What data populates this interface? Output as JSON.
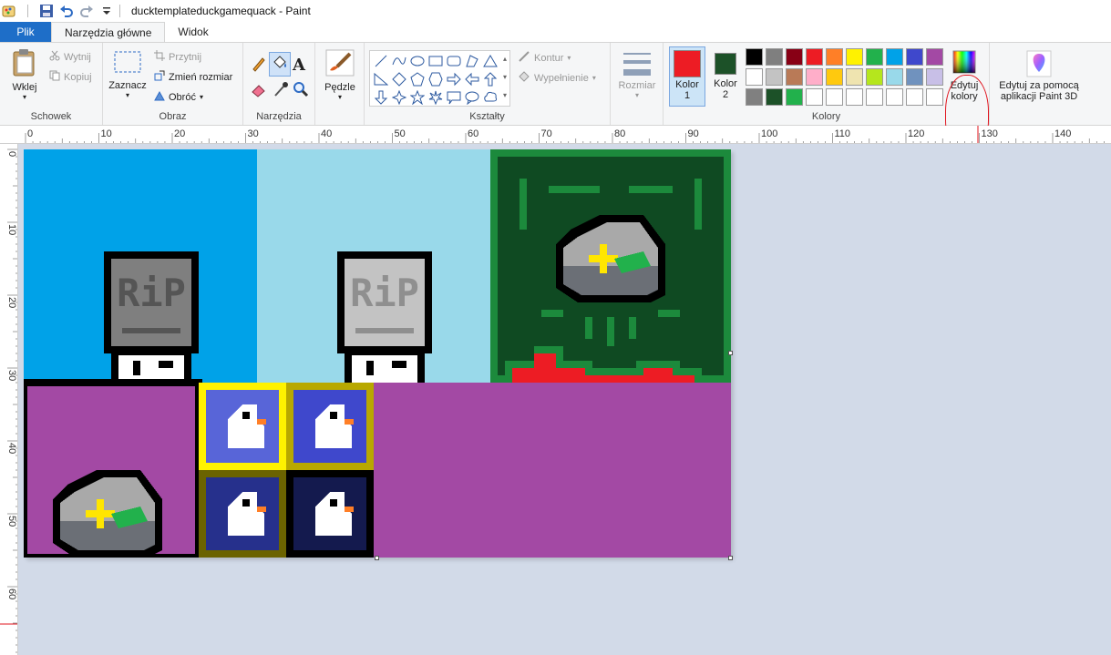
{
  "window": {
    "title": "ducktemplateduckgamequack - Paint"
  },
  "quick_access": [
    "save-icon",
    "undo-icon",
    "redo-icon",
    "dropdown-icon"
  ],
  "tabs": {
    "file": "Plik",
    "home": "Narzędzia główne",
    "view": "Widok"
  },
  "groups": {
    "clipboard": {
      "label": "Schowek",
      "paste": "Wklej",
      "cut": "Wytnij",
      "copy": "Kopiuj"
    },
    "image": {
      "label": "Obraz",
      "select": "Zaznacz",
      "crop": "Przytnij",
      "resize": "Zmień rozmiar",
      "rotate": "Obróć"
    },
    "tools": {
      "label": "Narzędzia"
    },
    "brushes": {
      "label": "Pędzle"
    },
    "shapes": {
      "label": "Kształty",
      "outline": "Kontur",
      "fill": "Wypełnienie"
    },
    "size": {
      "label": "Rozmiar"
    },
    "colors": {
      "label": "Kolory",
      "color1": "Kolor\n1",
      "color1_line1": "Kolor",
      "color1_line2": "1",
      "color2_line1": "Kolor",
      "color2_line2": "2",
      "color1_value": "#ed1c24",
      "color2_value": "#1c5128",
      "edit_line1": "Edytuj",
      "edit_line2": "kolory",
      "palette": [
        "#000000",
        "#7f7f7f",
        "#880015",
        "#ed1c24",
        "#ff7f27",
        "#fff200",
        "#22b14c",
        "#00a2e8",
        "#3f48cc",
        "#a349a4",
        "#ffffff",
        "#c3c3c3",
        "#b97a57",
        "#ffaec9",
        "#ffc90e",
        "#efe4b0",
        "#b5e61d",
        "#99d9ea",
        "#7092be",
        "#c8bfe7",
        "#808080",
        "#1c5128",
        "#22b14c",
        "#ffffff",
        "#ffffff",
        "#ffffff",
        "#ffffff",
        "#ffffff",
        "#ffffff",
        "#ffffff"
      ]
    },
    "paint3d": {
      "line1": "Edytuj za pomocą",
      "line2": "aplikacji Paint 3D"
    }
  },
  "ruler_top": [
    "0",
    "10",
    "20",
    "30",
    "40",
    "50",
    "60",
    "70",
    "80",
    "90",
    "100",
    "110",
    "120",
    "130",
    "140"
  ],
  "ruler_left": [
    "0",
    "10",
    "20",
    "30",
    "40",
    "50",
    "60"
  ],
  "canvas": {
    "panel_colors": {
      "sky_dark": "#00a2e8",
      "sky_light": "#99d9ea",
      "green_frame": "#1c8a3c",
      "green_dark": "#0f4a22",
      "purple": "#a349a4"
    },
    "tombstone_text": "RiP"
  }
}
